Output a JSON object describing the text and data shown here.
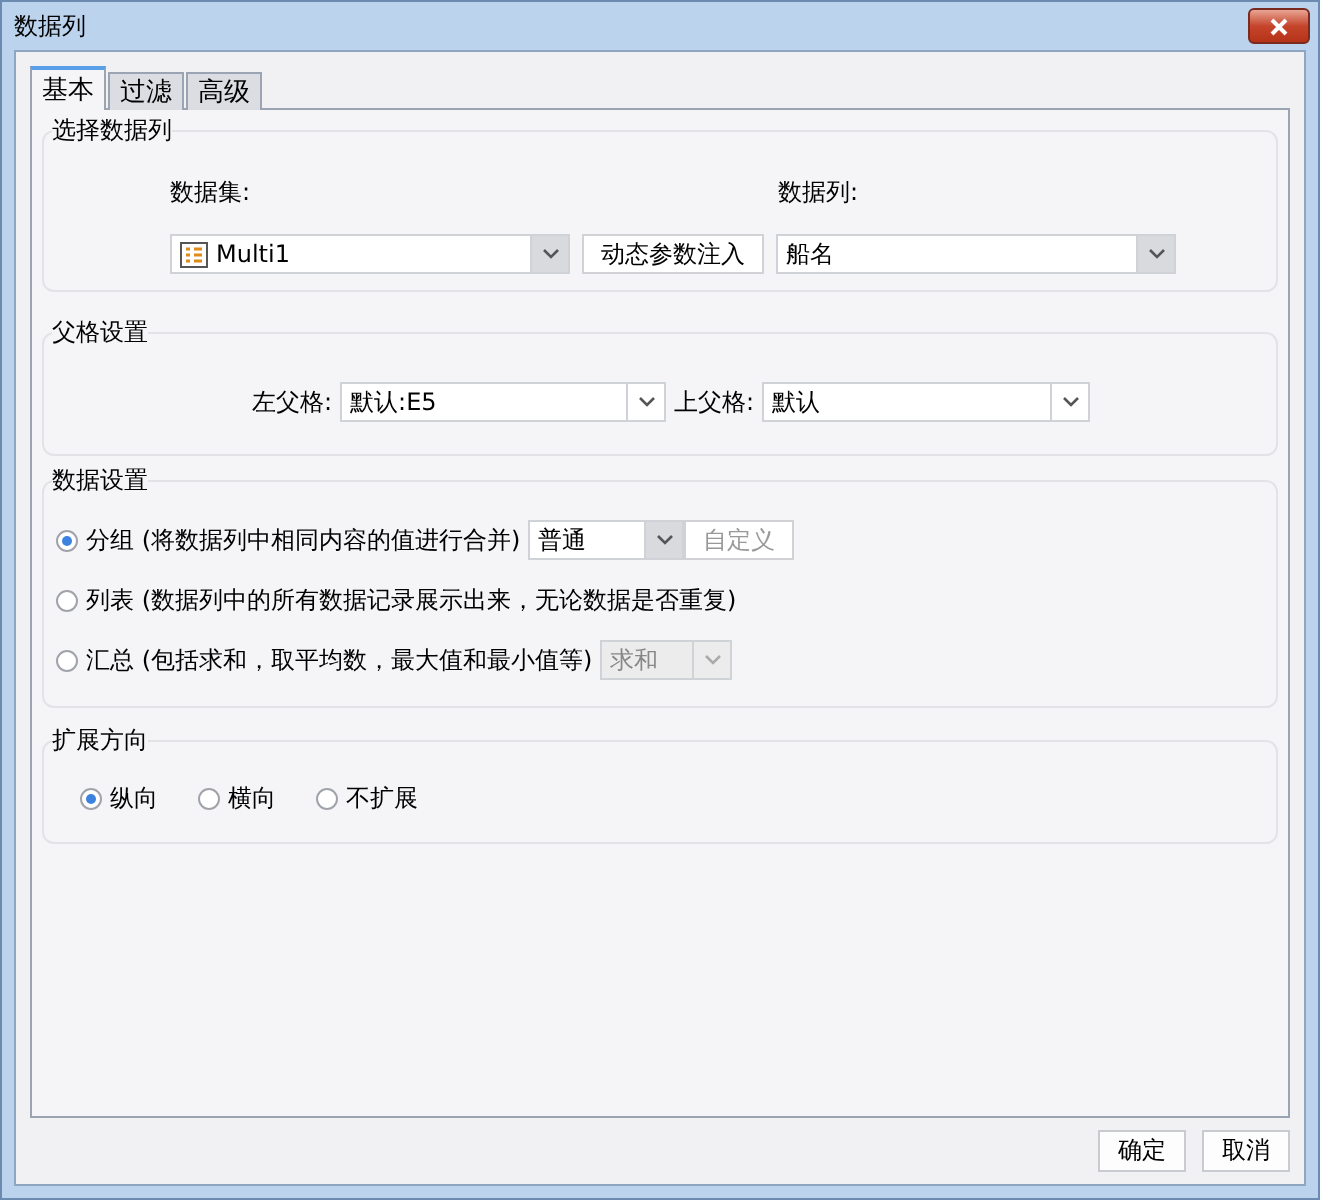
{
  "window": {
    "title": "数据列"
  },
  "tabs": [
    {
      "label": "基本",
      "selected": true
    },
    {
      "label": "过滤",
      "selected": false
    },
    {
      "label": "高级",
      "selected": false
    }
  ],
  "select_column": {
    "title": "选择数据列",
    "dataset_label": "数据集:",
    "dataset_value": "Multi1",
    "inject_button": "动态参数注入",
    "column_label": "数据列:",
    "column_value": "船名"
  },
  "parent_settings": {
    "title": "父格设置",
    "left_label": "左父格:",
    "left_value": "默认:E5",
    "top_label": "上父格:",
    "top_value": "默认"
  },
  "data_settings": {
    "title": "数据设置",
    "options": [
      {
        "label": "分组",
        "note": "(将数据列中相同内容的值进行合并)",
        "selected": true,
        "combo": {
          "value": "普通",
          "disabled": false
        },
        "button": {
          "label": "自定义",
          "disabled": true
        }
      },
      {
        "label": "列表",
        "note": "(数据列中的所有数据记录展示出来，无论数据是否重复)",
        "selected": false
      },
      {
        "label": "汇总",
        "note": "(包括求和，取平均数，最大值和最小值等)",
        "selected": false,
        "combo": {
          "value": "求和",
          "disabled": true
        }
      }
    ]
  },
  "expand_direction": {
    "title": "扩展方向",
    "options": [
      {
        "label": "纵向",
        "selected": true
      },
      {
        "label": "横向",
        "selected": false
      },
      {
        "label": "不扩展",
        "selected": false
      }
    ]
  },
  "buttons": [
    "确定",
    "取消"
  ]
}
